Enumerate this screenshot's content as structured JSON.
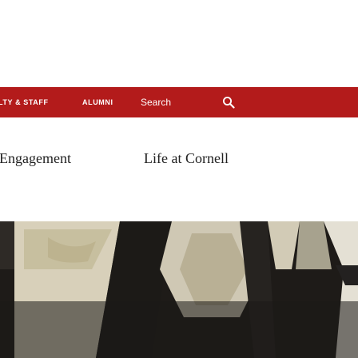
{
  "header": {
    "nav_links": [
      {
        "label": "LTY & STAFF"
      },
      {
        "label": "ALUMNI"
      }
    ],
    "search": {
      "label": "Search",
      "icon": "search-icon"
    }
  },
  "menu": {
    "items": [
      {
        "label": "Engagement"
      },
      {
        "label": "Life at Cornell"
      }
    ]
  },
  "colors": {
    "brand_red": "#b31b1b",
    "text_dark": "#222222",
    "hero_dark": "#1d1b19"
  }
}
